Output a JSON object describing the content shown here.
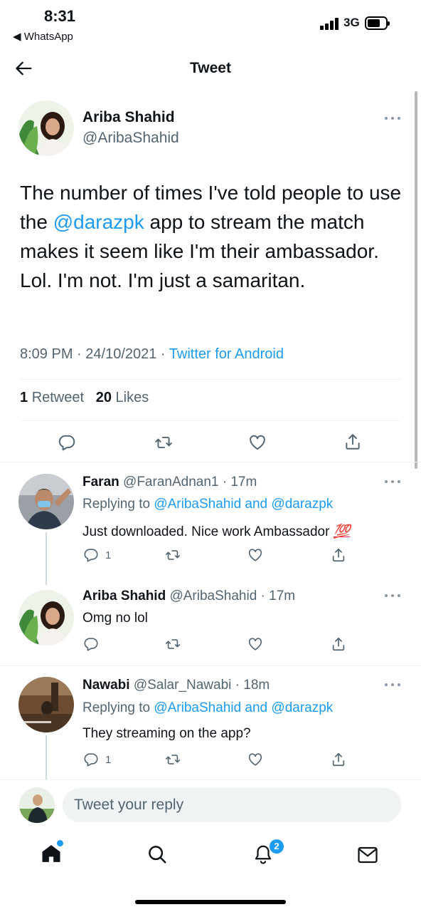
{
  "status_bar": {
    "time": "8:31",
    "back_app": "◀ WhatsApp",
    "network": "3G"
  },
  "header": {
    "title": "Tweet"
  },
  "main_tweet": {
    "author_name": "Ariba Shahid",
    "author_handle": "@AribaShahid",
    "text_before": "The number of times I've told people to use the ",
    "mention": "@darazpk",
    "text_after": " app to stream the match makes it seem like I'm their ambassador. Lol. I'm not. I'm just a samaritan.",
    "time": "8:09 PM",
    "date": "24/10/2021",
    "source": "Twitter for Android",
    "retweets_count": "1",
    "retweets_label": "Retweet",
    "likes_count": "20",
    "likes_label": "Likes"
  },
  "replies": [
    {
      "name": "Faran",
      "handle": "@FaranAdnan1",
      "age": "17m",
      "replying_prefix": "Replying to",
      "replying_to": "@AribaShahid and @darazpk",
      "text": "Just downloaded. Nice work Ambassador",
      "emoji": "💯",
      "reply_count": "1"
    },
    {
      "name": "Ariba Shahid",
      "handle": "@AribaShahid",
      "age": "17m",
      "text": "Omg no lol"
    },
    {
      "name": "Nawabi",
      "handle": "@Salar_Nawabi",
      "age": "18m",
      "replying_prefix": "Replying to",
      "replying_to": "@AribaShahid and @darazpk",
      "text": "They streaming on the app?",
      "reply_count": "1"
    }
  ],
  "compose": {
    "placeholder": "Tweet your reply"
  },
  "bottom_nav": {
    "items": [
      "home-icon",
      "search-icon",
      "notifications-icon",
      "messages-icon"
    ],
    "notification_badge": "2"
  },
  "colors": {
    "accent": "#1d9bf0",
    "secondary_text": "#536471",
    "divider": "#eff3f4"
  }
}
